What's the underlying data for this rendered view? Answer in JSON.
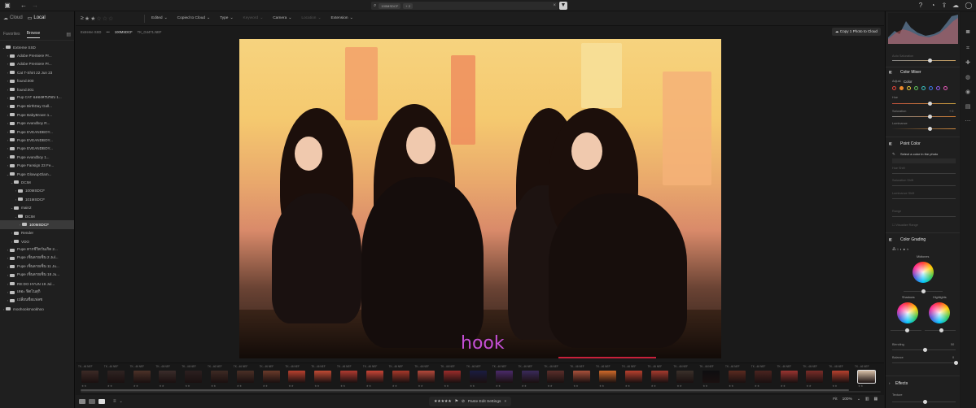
{
  "top": {
    "cloud_tab": "Cloud",
    "local_tab": "Local",
    "search_chip_1": "100MSDCF",
    "search_chip_2": "+ 2"
  },
  "left": {
    "subtabs": [
      "Favorites",
      "Browse"
    ],
    "tree": [
      {
        "label": "Extreme SSD",
        "depth": 0,
        "open": true
      },
      {
        "label": "Adobe Premiere Pr...",
        "depth": 1
      },
      {
        "label": "Adobe Premiere Pr...",
        "depth": 1
      },
      {
        "label": "Cat T-Shirt 22 Jun 23",
        "depth": 1
      },
      {
        "label": "found.000",
        "depth": 1
      },
      {
        "label": "found.001",
        "depth": 1
      },
      {
        "label": "Pup CAT ฉลองครบรอบ 1...",
        "depth": 1
      },
      {
        "label": "Pupe BirthDay Gall...",
        "depth": 1
      },
      {
        "label": "Pupe BabyBrown 1...",
        "depth": 1
      },
      {
        "label": "Pupe evandboy R...",
        "depth": 1
      },
      {
        "label": "Pupe EVEANDBOY...",
        "depth": 1
      },
      {
        "label": "Pupe EVEANDBOY...",
        "depth": 1
      },
      {
        "label": "Pupe EVEANDBOY...",
        "depth": 1
      },
      {
        "label": "Pupe evandboy 1...",
        "depth": 1
      },
      {
        "label": "Pupe Fansign 23 Fe...",
        "depth": 1
      },
      {
        "label": "Pupe GlowupGlam...",
        "depth": 1,
        "open": true
      },
      {
        "label": "DCIM",
        "depth": 2,
        "open": true
      },
      {
        "label": "100MSDCF",
        "depth": 3
      },
      {
        "label": "101MSDCF",
        "depth": 3
      },
      {
        "label": "main2",
        "depth": 2,
        "open": true
      },
      {
        "label": "DCIM",
        "depth": 3,
        "open": true
      },
      {
        "label": "100MSDCF",
        "depth": 4,
        "selected": true
      },
      {
        "label": "Render",
        "depth": 2
      },
      {
        "label": "VDO",
        "depth": 2
      },
      {
        "label": "Pupe ตากชีวิตวันเกิด 2...",
        "depth": 1
      },
      {
        "label": "Pupe เซ็นลายเซ็น 2 Jul...",
        "depth": 1
      },
      {
        "label": "Pupe เซ็นลายเซ็น 11 Ju...",
        "depth": 1
      },
      {
        "label": "Pupe เซ็นลายเซ็น 18 Ju...",
        "depth": 1
      },
      {
        "label": "RE:DO HYUN 19 Jul...",
        "depth": 1
      },
      {
        "label": "เดอะ ฟิตโนสุกิ",
        "depth": 1
      },
      {
        "label": "เปลี่ยนชื่อแฟลช",
        "depth": 1
      },
      {
        "label": "moohookmookhoo",
        "depth": 0
      }
    ]
  },
  "toolbar": {
    "filters": [
      {
        "label": "Edited",
        "dim": false
      },
      {
        "label": "Copied to Cloud",
        "dim": false
      },
      {
        "label": "Type",
        "dim": false
      },
      {
        "label": "Keyword",
        "dim": true
      },
      {
        "label": "Camera",
        "dim": false
      },
      {
        "label": "Location",
        "dim": true
      },
      {
        "label": "Extension",
        "dim": false
      }
    ]
  },
  "breadcrumb": {
    "root": "Extreme SSD",
    "ellipsis": "•••",
    "folder": "100MSDCF",
    "file": "TK_G4471.NEF",
    "copy_button": "Copy 1 Photo to Cloud"
  },
  "photo": {
    "watermark": "hook"
  },
  "filmstrip": {
    "count": 31,
    "label": "TK...46",
    "label_suffix": "NEF",
    "stars": "★★"
  },
  "bottom": {
    "stars": "★★★★★",
    "paste": "Paste Edit Settings",
    "fit": "Fit",
    "zoom": "100%"
  },
  "right": {
    "auto_saturation": "Auto Saturation",
    "color_mixer": "Color Mixer",
    "adjust": "Adjust",
    "adjust_value": "Color",
    "hue": "Hue",
    "saturation": "Saturation",
    "luminance": "Luminance",
    "sat_value": "+ 0",
    "point_color": "Point Color",
    "select_color": "Select a color in the photo",
    "hue_shift": "Hue Shift",
    "saturation_shift": "Saturation Shift",
    "luminance_shift": "Luminance Shift",
    "range": "Range",
    "visualize": "Visualize Range",
    "color_grading": "Color Grading",
    "midtones": "Midtones",
    "shadows": "Shadows",
    "highlights": "Highlights",
    "blending": "Blending",
    "balance": "Balance",
    "effects": "Effects",
    "texture": "Texture",
    "blending_value": "50",
    "balance_value": "0"
  },
  "colors": {
    "accent": "#e8e8e8",
    "panel": "#1f1f1f",
    "watermark": "#c54fd6"
  }
}
